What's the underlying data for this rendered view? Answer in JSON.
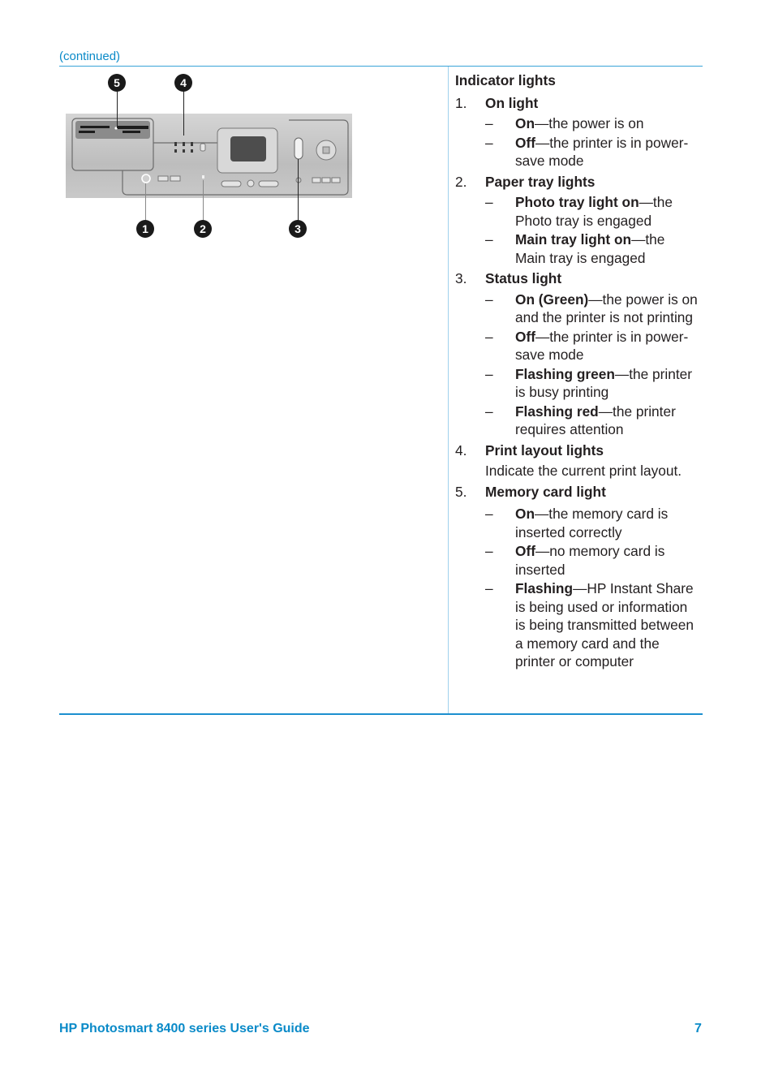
{
  "header": {
    "continued": "(continued)"
  },
  "figure": {
    "callouts": [
      "1",
      "2",
      "3",
      "4",
      "5"
    ]
  },
  "indicator_lights": {
    "title": "Indicator lights",
    "items": [
      {
        "num": "1.",
        "title": "On light",
        "bullets": [
          {
            "term": "On",
            "text": "—the power is on"
          },
          {
            "term": "Off",
            "text": "—the printer is in power-save mode"
          }
        ]
      },
      {
        "num": "2.",
        "title": "Paper tray lights",
        "bullets": [
          {
            "term": "Photo tray light on",
            "text": "—the Photo tray is engaged"
          },
          {
            "term": "Main tray light on",
            "text": "—the Main tray is engaged"
          }
        ]
      },
      {
        "num": "3.",
        "title": "Status light",
        "bullets": [
          {
            "term": "On (Green)",
            "text": "—the power is on and the printer is not printing"
          },
          {
            "term": "Off",
            "text": "—the printer is in power-save mode"
          },
          {
            "term": "Flashing green",
            "text": "—the printer is busy printing"
          },
          {
            "term": "Flashing red",
            "text": "—the printer requires attention"
          }
        ]
      },
      {
        "num": "4.",
        "title": "Print layout lights",
        "desc": "Indicate the current print layout."
      },
      {
        "num": "5.",
        "title": "Memory card light",
        "bullets": [
          {
            "term": "On",
            "text": "—the memory card is inserted correctly"
          },
          {
            "term": "Off",
            "text": "—no memory card is inserted"
          },
          {
            "term": "Flashing",
            "text": "—HP Instant Share is being used or information is being transmitted between a memory card and the printer or computer"
          }
        ]
      }
    ]
  },
  "footer": {
    "title": "HP Photosmart 8400 series User's Guide",
    "page": "7"
  },
  "colors": {
    "accent": "#0a8ac8",
    "rule": "#1c8fcf"
  },
  "dash": "–"
}
